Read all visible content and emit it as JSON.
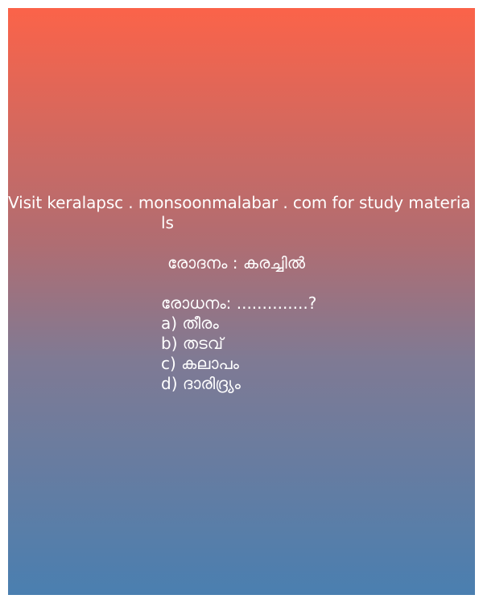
{
  "header": {
    "line1": "Visit keralapsc . monsoonmalabar . com for study materia",
    "line2": "ls"
  },
  "question": {
    "example": "രോദനം : കരച്ചിൽ",
    "prompt": "രോധനം: ..............?"
  },
  "options": [
    "a) തീരം",
    "b) തടവ്",
    "c) കലാപം",
    "d) ദാരിദ്ര്യം"
  ],
  "colors": {
    "gradient_top": "#fb6349",
    "gradient_bottom": "#4a7fb0",
    "text": "#ffffff"
  }
}
